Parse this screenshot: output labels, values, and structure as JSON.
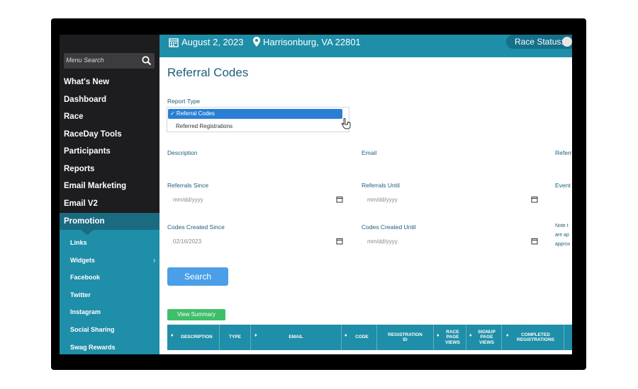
{
  "header": {
    "date": "August 2, 2023",
    "location": "Harrisonburg, VA 22801",
    "race_status_label": "Race Status:"
  },
  "sidebar": {
    "search_placeholder": "Menu Search",
    "items": [
      {
        "label": "What's New"
      },
      {
        "label": "Dashboard"
      },
      {
        "label": "Race"
      },
      {
        "label": "RaceDay Tools"
      },
      {
        "label": "Participants"
      },
      {
        "label": "Reports"
      },
      {
        "label": "Email Marketing"
      },
      {
        "label": "Email V2"
      }
    ],
    "active_item": "Promotion",
    "sub_items": [
      {
        "label": "Links"
      },
      {
        "label": "Widgets"
      },
      {
        "label": "Facebook"
      },
      {
        "label": "Twitter"
      },
      {
        "label": "Instagram"
      },
      {
        "label": "Social Sharing"
      },
      {
        "label": "Swag Rewards"
      }
    ]
  },
  "main": {
    "title": "Referral Codes",
    "report_type_label": "Report Type",
    "report_options": [
      "Referral Codes",
      "Referred Registrations"
    ],
    "selected_option": "✓ Referral Codes",
    "description_label": "Description",
    "email_label": "Email",
    "referrer_label_partial": "Referr",
    "referrals_since_label": "Referrals Since",
    "referrals_until_label": "Referrals Until",
    "event_label_partial": "Event",
    "codes_created_since_label": "Codes Created Since",
    "codes_created_until_label": "Codes Created Until",
    "note_partial": [
      "Note t",
      "are ap",
      "approx"
    ],
    "referrals_since_value": "mm/dd/yyyy",
    "referrals_until_value": "mm/dd/yyyy",
    "codes_since_value": "02/16/2023",
    "codes_until_value": "mm/dd/yyyy",
    "search_button": "Search",
    "view_summary_button": "View Summary"
  },
  "table": {
    "headers": [
      "DESCRIPTION",
      "TYPE",
      "EMAIL",
      "CODE",
      "REGISTRATION ID",
      "RACE PAGE VIEWS",
      "SIGNUP PAGE VIEWS",
      "COMPLETED REGISTRATIONS"
    ]
  },
  "colors": {
    "teal": "#1f8ea8",
    "dark_teal": "#1a6b80",
    "sidebar_dark": "#1d1d1f",
    "title_blue": "#1d5e7a",
    "button_blue": "#4a9fe8",
    "button_green": "#3fbf6a"
  }
}
